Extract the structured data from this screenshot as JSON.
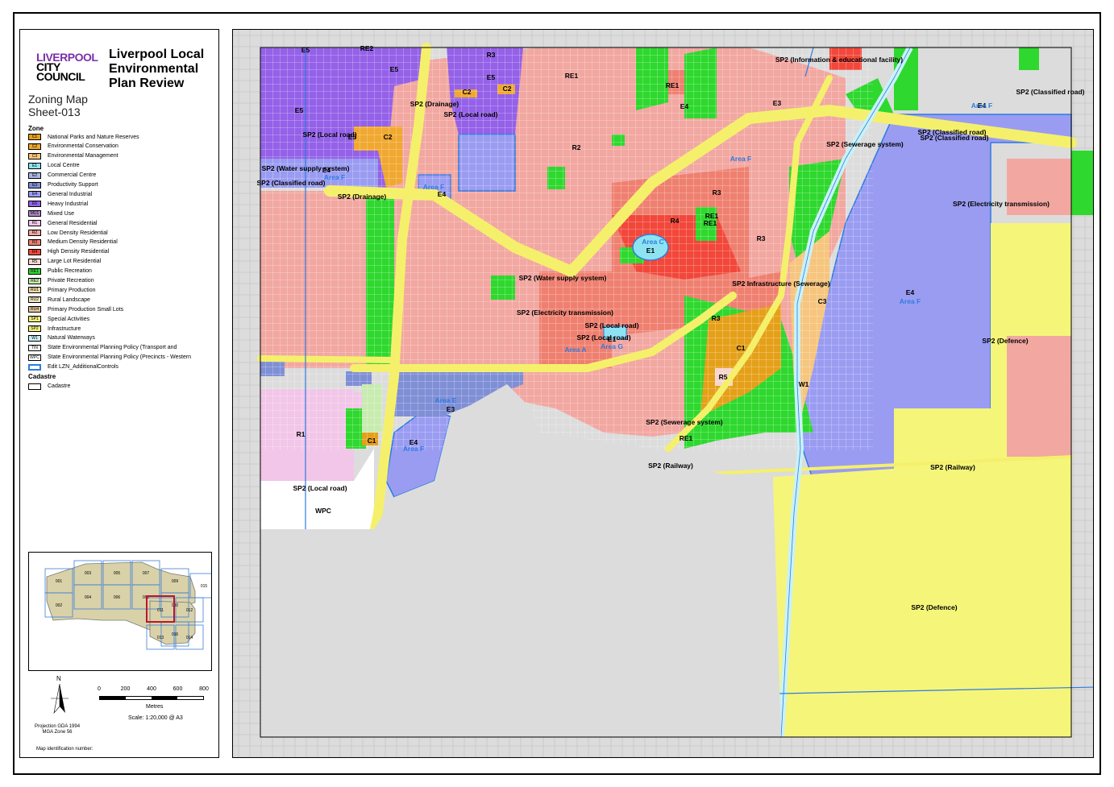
{
  "logo": {
    "line1": "LIVERPOOL",
    "line2": "CITY",
    "line3": "COUNCIL"
  },
  "title": "Liverpool Local Environmental Plan Review",
  "map_type": "Zoning Map",
  "sheet": "Sheet-013",
  "legend": {
    "zone_heading": "Zone",
    "items": [
      {
        "code": "C1",
        "label": "National Parks and Nature Reserves",
        "color": "#e5a019"
      },
      {
        "code": "C2",
        "label": "Environmental Conservation",
        "color": "#f0a830"
      },
      {
        "code": "C3",
        "label": "Environmental Management",
        "color": "#f6c57e"
      },
      {
        "code": "E1",
        "label": "Local Centre",
        "color": "#8ee3f2"
      },
      {
        "code": "E2",
        "label": "Commercial Centre",
        "color": "#a7b8e8"
      },
      {
        "code": "E3",
        "label": "Productivity Support",
        "color": "#7f8fd6"
      },
      {
        "code": "E4",
        "label": "General Industrial",
        "color": "#9a9cf2"
      },
      {
        "code": "E5",
        "label": "Heavy Industrial",
        "color": "#9461e8"
      },
      {
        "code": "MU1",
        "label": "Mixed Use",
        "color": "#b08ac8"
      },
      {
        "code": "R1",
        "label": "General Residential",
        "color": "#f2c6e8"
      },
      {
        "code": "R2",
        "label": "Low Density Residential",
        "color": "#f2a7a1"
      },
      {
        "code": "R3",
        "label": "Medium Density Residential",
        "color": "#ef8070"
      },
      {
        "code": "R4",
        "label": "High Density Residential",
        "color": "#f2473a"
      },
      {
        "code": "R5",
        "label": "Large Lot Residential",
        "color": "#f7d6d0"
      },
      {
        "code": "RE1",
        "label": "Public Recreation",
        "color": "#2ed82e"
      },
      {
        "code": "RE2",
        "label": "Private Recreation",
        "color": "#c8ecb0"
      },
      {
        "code": "RU1",
        "label": "Primary Production",
        "color": "#f1d9a4"
      },
      {
        "code": "RU2",
        "label": "Rural Landscape",
        "color": "#f4e7c3"
      },
      {
        "code": "RU4",
        "label": "Primary Production Small Lots",
        "color": "#e5c79a"
      },
      {
        "code": "SP1",
        "label": "Special Activities",
        "color": "#f7f27a"
      },
      {
        "code": "SP2",
        "label": "Infrastructure",
        "color": "#f5f57a"
      },
      {
        "code": "W1",
        "label": "Natural Waterways",
        "color": "#c9f2f7"
      },
      {
        "code": "TIN",
        "label": "State Environmental Planning Policy (Transport and",
        "color": "#ffffff"
      },
      {
        "code": "WPC",
        "label": "State Environmental Planning Policy (Precincts - Western",
        "color": "#ffffff"
      }
    ],
    "additional_label": "Edit LZN_AdditionalControls",
    "cadastre_heading": "Cadastre",
    "cadastre_label": "Cadastre"
  },
  "inset_sheets": [
    "001",
    "002",
    "003",
    "004",
    "005",
    "006",
    "007",
    "008",
    "009",
    "010",
    "011",
    "012",
    "013",
    "014",
    "015",
    "016"
  ],
  "scale": {
    "ticks": [
      "0",
      "200",
      "400",
      "600",
      "800"
    ],
    "unit": "Metres",
    "text": "Scale: 1:20,000 @ A3"
  },
  "north_label": "N",
  "projection": "Projection GDA 1994\nMGA Zone 56",
  "projection_line1": "Projection GDA 1994",
  "projection_line2": "MGA Zone 56",
  "map_id_label": "Map identification number:",
  "colors": {
    "road": "#f5f06b",
    "background": "#dcdcdc",
    "cadastre": "#ffffff",
    "additional": "#2d7be0"
  },
  "map_labels": [
    {
      "t": "E5"
    },
    {
      "t": "RE2"
    },
    {
      "t": "E5"
    },
    {
      "t": "E5"
    },
    {
      "t": "C2"
    },
    {
      "t": "C2"
    },
    {
      "t": "SP2 (Drainage)"
    },
    {
      "t": "SP2 (Local road)"
    },
    {
      "t": "E5"
    },
    {
      "t": "E5"
    },
    {
      "t": "SP2 (Water supply system)"
    },
    {
      "t": "SP2 (Local road)"
    },
    {
      "t": "C2"
    },
    {
      "t": "E4"
    },
    {
      "t": "Area F"
    },
    {
      "t": "E4"
    },
    {
      "t": "Area F"
    },
    {
      "t": "Area F"
    },
    {
      "t": "E4"
    },
    {
      "t": "SP2 (Classified road)"
    },
    {
      "t": "SP2 (Drainage)"
    },
    {
      "t": "R3"
    },
    {
      "t": "RE1"
    },
    {
      "t": "RE1"
    },
    {
      "t": "R3"
    },
    {
      "t": "R2"
    },
    {
      "t": "R4"
    },
    {
      "t": "RE1"
    },
    {
      "t": "R3"
    },
    {
      "t": "Area C"
    },
    {
      "t": "E1"
    },
    {
      "t": "SP2 (Water supply system)"
    },
    {
      "t": "SP2 (Electricity transmission)"
    },
    {
      "t": "SP2 (Local road)"
    },
    {
      "t": "Area E"
    },
    {
      "t": "E3"
    },
    {
      "t": "E4"
    },
    {
      "t": "Area F"
    },
    {
      "t": "R1"
    },
    {
      "t": "SP2 (Local road)"
    },
    {
      "t": "WPC"
    },
    {
      "t": "C1"
    },
    {
      "t": "RE1"
    },
    {
      "t": "SP2 (Sewerage system)"
    },
    {
      "t": "SP2 (Railway)"
    },
    {
      "t": "C1"
    },
    {
      "t": "R5"
    },
    {
      "t": "R3"
    },
    {
      "t": "SP2 Infrastructure (Sewerage)"
    },
    {
      "t": "C3"
    },
    {
      "t": "W1"
    },
    {
      "t": "E4"
    },
    {
      "t": "Area F"
    },
    {
      "t": "SP2 (Defence)"
    },
    {
      "t": "SP2 (Defence)"
    },
    {
      "t": "SP2 (Railway)"
    },
    {
      "t": "SP2 (Classified road)"
    },
    {
      "t": "SP2 (Electricity transmission)"
    },
    {
      "t": "SP2 (Information & educational facility)"
    },
    {
      "t": "SP2 (Classified road)"
    },
    {
      "t": "E4"
    },
    {
      "t": "Area F"
    },
    {
      "t": "SP2 (Sewerage system)"
    },
    {
      "t": "SP2 (Classified road)"
    },
    {
      "t": "RE1"
    },
    {
      "t": "E3"
    },
    {
      "t": "Area A"
    },
    {
      "t": "SP2 (Local road)"
    },
    {
      "t": "Area G"
    },
    {
      "t": "E1"
    }
  ]
}
